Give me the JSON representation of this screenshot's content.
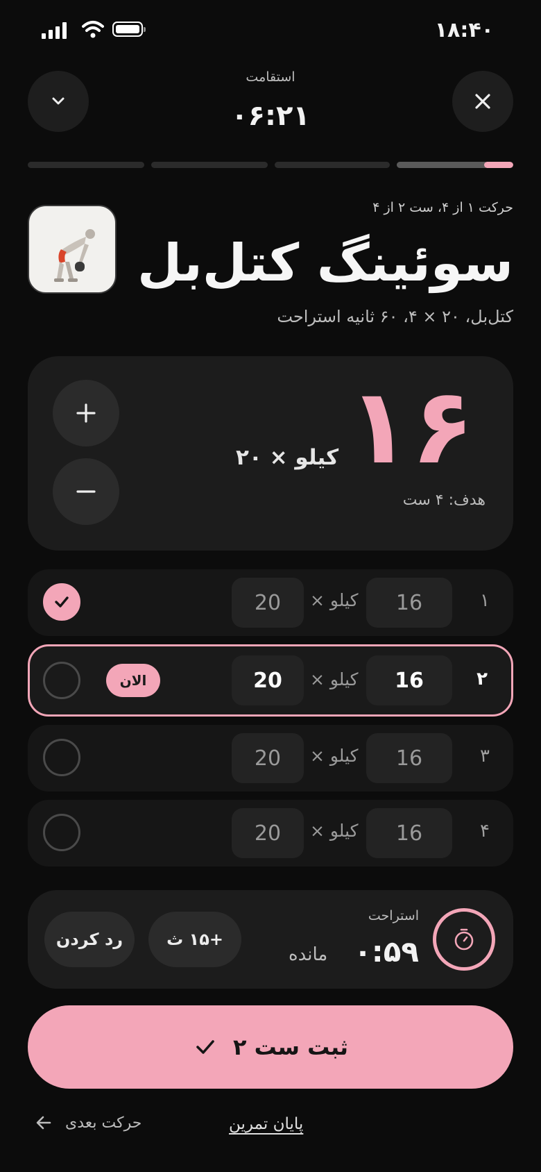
{
  "status_bar": {
    "time": "۱۸:۴۰"
  },
  "header": {
    "workout_name": "استقامت",
    "elapsed": "۰۶:۲۱"
  },
  "progress": {
    "segments": 4,
    "current_segment": 4,
    "current_fill": 0.25
  },
  "exercise": {
    "meta": "حرکت ۱ از ۴، ست ۲ از ۴",
    "title": "سوئینگ کتل‌بل",
    "subtitle": "کتل‌بل، ۲۰ × ۴، ۶۰ ثانیه استراحت"
  },
  "counter": {
    "value": "۱۶",
    "weight": "کیلو × ۲۰",
    "goal": "هدف: ۴ ست"
  },
  "unit_label": "کیلو ×",
  "sets": [
    {
      "index": "۱",
      "reps": "16",
      "kg": "20",
      "done": true
    },
    {
      "index": "۲",
      "reps": "16",
      "kg": "20",
      "done": false,
      "badge": "الان"
    },
    {
      "index": "۳",
      "reps": "16",
      "kg": "20",
      "done": false
    },
    {
      "index": "۴",
      "reps": "16",
      "kg": "20",
      "done": false
    }
  ],
  "rest": {
    "label": "استراحت",
    "time": "۰:۵۹",
    "remaining_label": "مانده",
    "add_button": "+۱۵ ث",
    "skip_button": "رد کردن"
  },
  "main_button": {
    "label": "ثبت ست ۲"
  },
  "footer": {
    "end_link": "پایان تمرین",
    "next_link": "حرکت بعدی"
  },
  "colors": {
    "accent": "#f3a6b8",
    "background": "#0c0c0c",
    "card": "#1c1c1c"
  }
}
